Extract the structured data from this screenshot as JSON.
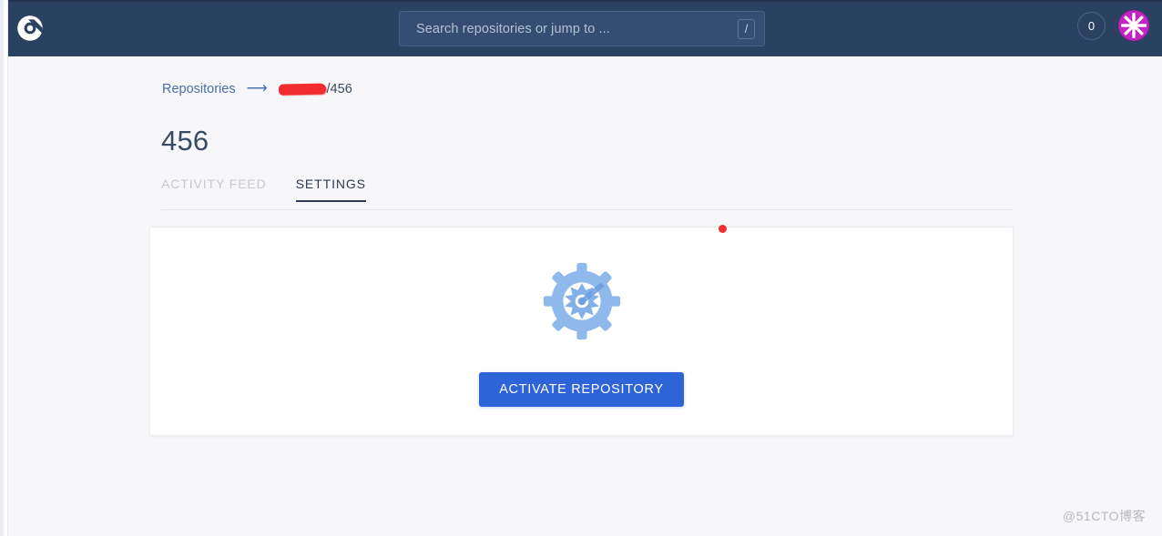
{
  "app": {
    "logo_name": "drone-logo-icon",
    "header_bg": "#2b4161",
    "page_bg": "#f7f7f9"
  },
  "topnav": {
    "search": {
      "placeholder": "Search repositories or jump to ...",
      "value": "",
      "shortcut_badge": "/"
    },
    "build_count": "0",
    "avatar_label": "user-avatar"
  },
  "breadcrumb": {
    "root_label": "Repositories",
    "separator": "⟶",
    "redacted_owner": "",
    "current_label": "/456"
  },
  "page": {
    "title": "456"
  },
  "tabs": [
    {
      "label": "ACTIVITY FEED",
      "active": false
    },
    {
      "label": "SETTINGS",
      "active": true
    }
  ],
  "card": {
    "icon_name": "gear-icon",
    "icon_color": "#8fb8ec",
    "activate_button_label": "ACTIVATE REPOSITORY",
    "activate_button_color": "#2d64d8"
  },
  "marker": {
    "dot_color": "#f03030"
  },
  "watermark": {
    "text": "@51CTO博客"
  }
}
